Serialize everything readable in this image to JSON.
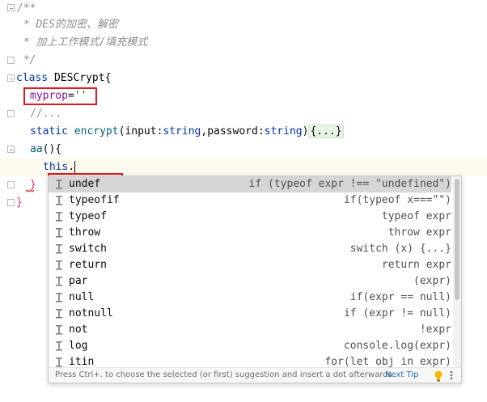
{
  "code": {
    "line1": "/**",
    "line2": " * DES的加密、解密",
    "line3": " * 加上工作模式/填充模式",
    "line4": " */",
    "line5_kw": "class",
    "line5_name": "DESCrypt",
    "line5_brace": "{",
    "line6_prop": "myprop",
    "line6_eq": "=",
    "line6_str": "''",
    "line7": "//...",
    "line8_kw": "static",
    "line8_fn": "encrypt",
    "line8_p1": "input",
    "line8_t1": "string",
    "line8_p2": "password",
    "line8_t2": "string",
    "line8_fold": "{...}",
    "line9_fn": "aa",
    "line9_rest": "(){",
    "line10_this": "this",
    "line10_dot": ".",
    "line11": "}",
    "line12": "}"
  },
  "completion": {
    "items": [
      {
        "name": "undef",
        "tail": "if (typeof expr !== \"undefined\")"
      },
      {
        "name": "typeofif",
        "tail": "if(typeof x===\"\")"
      },
      {
        "name": "typeof",
        "tail": "typeof expr"
      },
      {
        "name": "throw",
        "tail": "throw expr"
      },
      {
        "name": "switch",
        "tail": "switch (x) {...}"
      },
      {
        "name": "return",
        "tail": "return expr"
      },
      {
        "name": "par",
        "tail": "(expr)"
      },
      {
        "name": "null",
        "tail": "if(expr == null)"
      },
      {
        "name": "notnull",
        "tail": "if (expr != null)"
      },
      {
        "name": "not",
        "tail": "!expr"
      },
      {
        "name": "log",
        "tail": "console.log(expr)"
      },
      {
        "name": "itin",
        "tail": "for(let obj in expr)"
      }
    ],
    "footer_text": "Press Ctrl+. to choose the selected (or first) suggestion and insert a dot afterwards",
    "next_tip": "Next Tip",
    "icons": {
      "item": "postfix-template-icon",
      "bulb": "lightbulb-icon",
      "more": "more-vertical-icon"
    }
  },
  "colors": {
    "highlight_box": "#e0191e",
    "selected_row": "#d5d5d5",
    "keyword": "#0033b3",
    "property": "#871094",
    "string": "#067d17"
  }
}
